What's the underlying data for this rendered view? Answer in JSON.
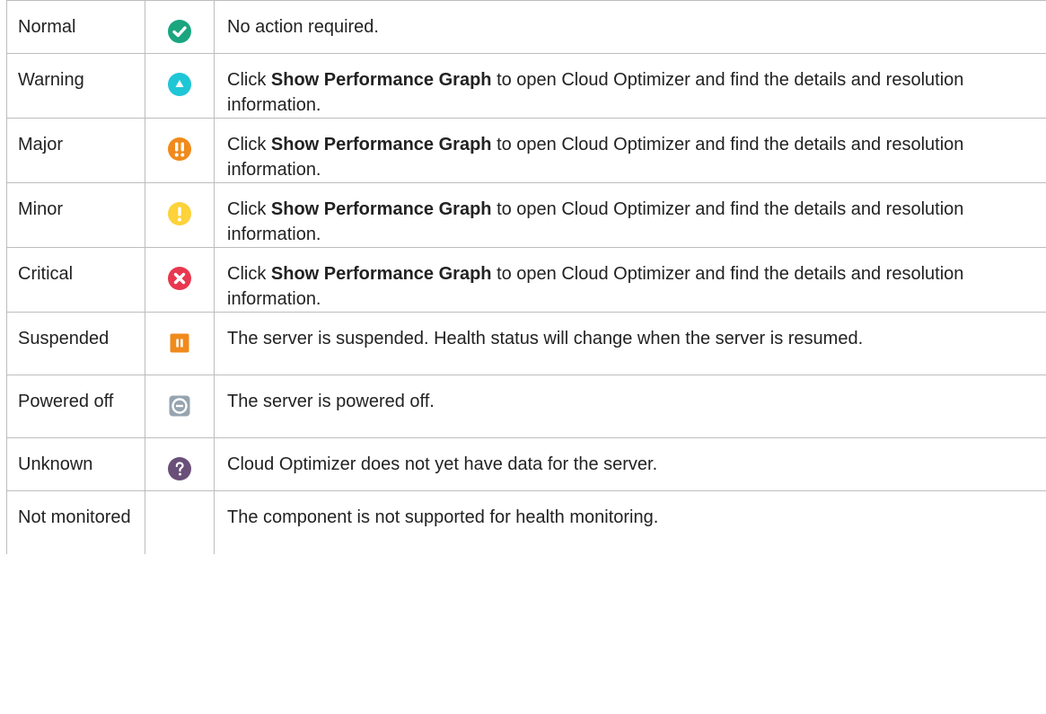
{
  "rows": [
    {
      "status": "Normal",
      "icon": "check-circle-icon",
      "color": "#1aa57f",
      "desc": {
        "plain": "No action required."
      }
    },
    {
      "status": "Warning",
      "icon": "triangle-up-circle-icon",
      "color": "#1fc6d6",
      "desc": {
        "pre": "Click ",
        "bold": "Show Performance Graph",
        "post": " to open Cloud Optimizer and find the details and resolution information."
      }
    },
    {
      "status": "Major",
      "icon": "double-exclamation-icon",
      "color": "#f08a1c",
      "desc": {
        "pre": "Click ",
        "bold": "Show Performance Graph",
        "post": " to open Cloud Optimizer and find the details and resolution information."
      }
    },
    {
      "status": "Minor",
      "icon": "exclamation-circle-icon",
      "color": "#fdd23a",
      "desc": {
        "pre": "Click ",
        "bold": "Show Performance Graph",
        "post": " to open Cloud Optimizer and find the details and resolution information."
      }
    },
    {
      "status": "Critical",
      "icon": "x-circle-icon",
      "color": "#e8384f",
      "desc": {
        "pre": "Click ",
        "bold": "Show Performance Graph",
        "post": " to open Cloud Optimizer and find the details and resolution information."
      }
    },
    {
      "status": "Suspended",
      "icon": "pause-square-icon",
      "color": "#f08a1c",
      "desc": {
        "plain": "The server is suspended. Health status will change when the server is resumed."
      }
    },
    {
      "status": "Powered off",
      "icon": "minus-circle-square-icon",
      "color": "#97a4b0",
      "desc": {
        "plain": "The server is powered off."
      }
    },
    {
      "status": "Unknown",
      "icon": "question-circle-icon",
      "color": "#6a4f78",
      "desc": {
        "plain": "Cloud Optimizer does not yet have data for the server."
      }
    },
    {
      "status": "Not monitored",
      "icon": "",
      "color": "",
      "desc": {
        "plain": "The component is not supported for health monitoring."
      }
    }
  ]
}
